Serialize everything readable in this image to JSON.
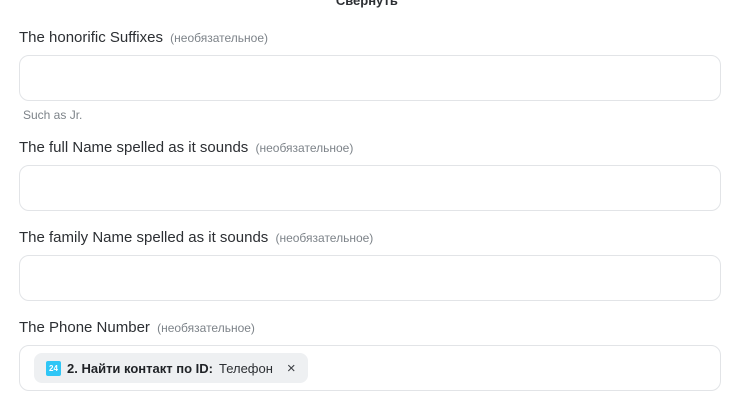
{
  "collapse": {
    "label": "Свернуть",
    "chevron": "^"
  },
  "optional_label": "(необязательное)",
  "fields": [
    {
      "label": "The honorific Suffixes",
      "value": "",
      "hint": "Such as Jr."
    },
    {
      "label": "The full Name spelled as it sounds",
      "value": ""
    },
    {
      "label": "The family Name spelled as it sounds",
      "value": ""
    },
    {
      "label": "The Phone Number",
      "chip": {
        "icon_text": "24",
        "step": "2. Найти контакт по ID:",
        "field": "Телефон",
        "remove": "×"
      }
    }
  ],
  "colors": {
    "chip_icon": "#2fc6f6",
    "chip_bg": "#eef0f2",
    "border": "#e2e4e7"
  }
}
